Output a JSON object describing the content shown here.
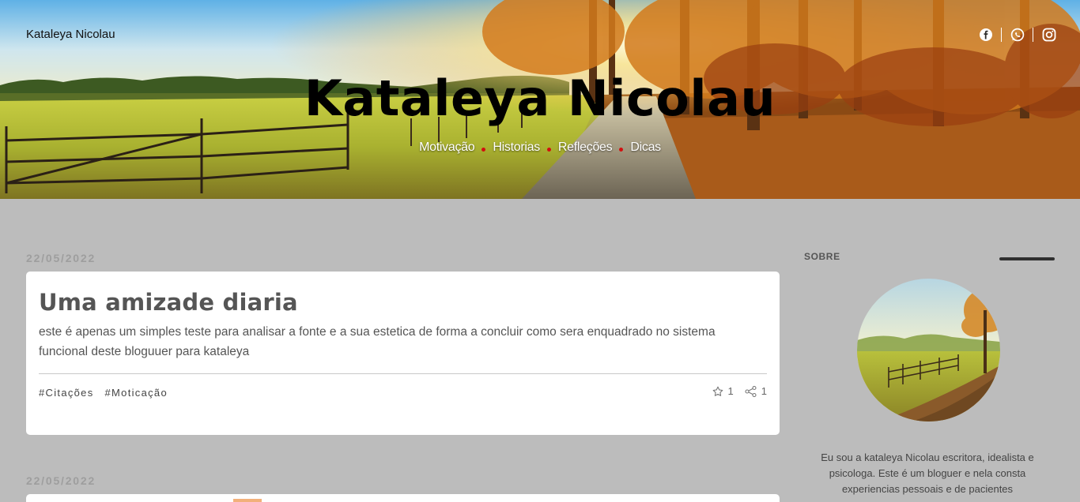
{
  "header": {
    "site_name": "Kataleya Nicolau",
    "title": "Kataleya Nicolau",
    "nav": [
      "Motivação",
      "Historias",
      "Refleções",
      "Dicas"
    ],
    "nav_dot_color": "#d20f0f",
    "social_icons": [
      "facebook-icon",
      "whatsapp-icon",
      "instagram-icon"
    ]
  },
  "posts": [
    {
      "date": "22/05/2022",
      "title": "Uma amizade diaria",
      "excerpt": "este é apenas um simples teste para analisar a fonte e a sua estetica de forma a concluir como sera enquadrado no sistema funcional deste bloguuer para kataleya",
      "tags": [
        "#Citações",
        "#Moticação"
      ],
      "likes": "1",
      "shares": "1"
    },
    {
      "date": "22/05/2022"
    }
  ],
  "sidebar": {
    "heading": "SOBRE",
    "about": "Eu sou a kataleya Nicolau escritora, idealista e psicologa. Este é um bloguer e nela consta experiencias pessoais e de pacientes"
  },
  "colors": {
    "page_bg": "#bcbcbc",
    "card_bg": "#ffffff",
    "date_color": "#9e9e9e"
  }
}
